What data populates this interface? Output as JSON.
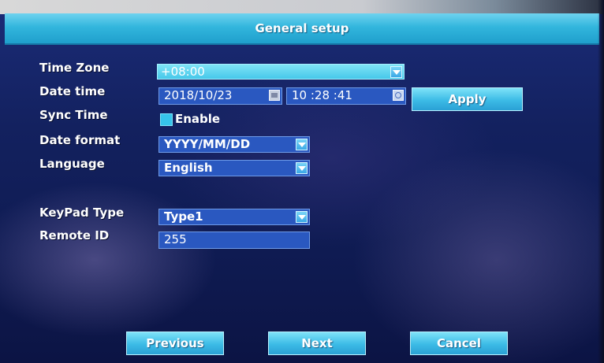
{
  "window": {
    "title": "General setup"
  },
  "fields": {
    "time_zone": {
      "label": "Time Zone",
      "value": "+08:00"
    },
    "date_time": {
      "label": "Date time",
      "date": "2018/10/23",
      "time": "10 :28 :41"
    },
    "sync_time": {
      "label": "Sync Time",
      "checkbox_label": "Enable",
      "checked": true
    },
    "date_format": {
      "label": "Date format",
      "value": "YYYY/MM/DD"
    },
    "language": {
      "label": "Language",
      "value": "English"
    },
    "keypad_type": {
      "label": "KeyPad Type",
      "value": "Type1"
    },
    "remote_id": {
      "label": "Remote ID",
      "value": "255"
    }
  },
  "buttons": {
    "apply": "Apply",
    "previous": "Previous",
    "next": "Next",
    "cancel": "Cancel"
  },
  "icons": [
    "dropdown-arrow-icon",
    "calendar-icon",
    "clock-icon",
    "checkbox-icon"
  ],
  "colors": {
    "accent": "#3cbbe6",
    "field_background": "#2a58c0",
    "panel_background": "#13215f"
  }
}
